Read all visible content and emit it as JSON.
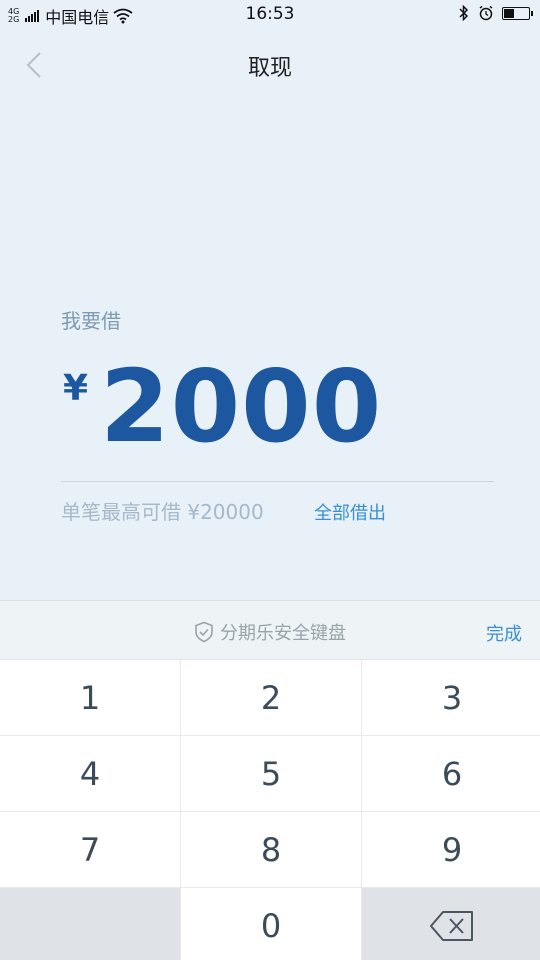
{
  "status_bar": {
    "network_top": "4G",
    "network_bottom": "2G",
    "carrier": "中国电信",
    "time": "16:53",
    "battery_level": 0.45
  },
  "nav": {
    "title": "取现"
  },
  "loan": {
    "label": "我要借",
    "currency": "¥",
    "amount": "2000",
    "max_text": "单笔最高可借 ¥20000",
    "borrow_all": "全部借出"
  },
  "keyboard": {
    "title": "分期乐安全键盘",
    "done": "完成",
    "keys": [
      "1",
      "2",
      "3",
      "4",
      "5",
      "6",
      "7",
      "8",
      "9",
      "0"
    ]
  }
}
